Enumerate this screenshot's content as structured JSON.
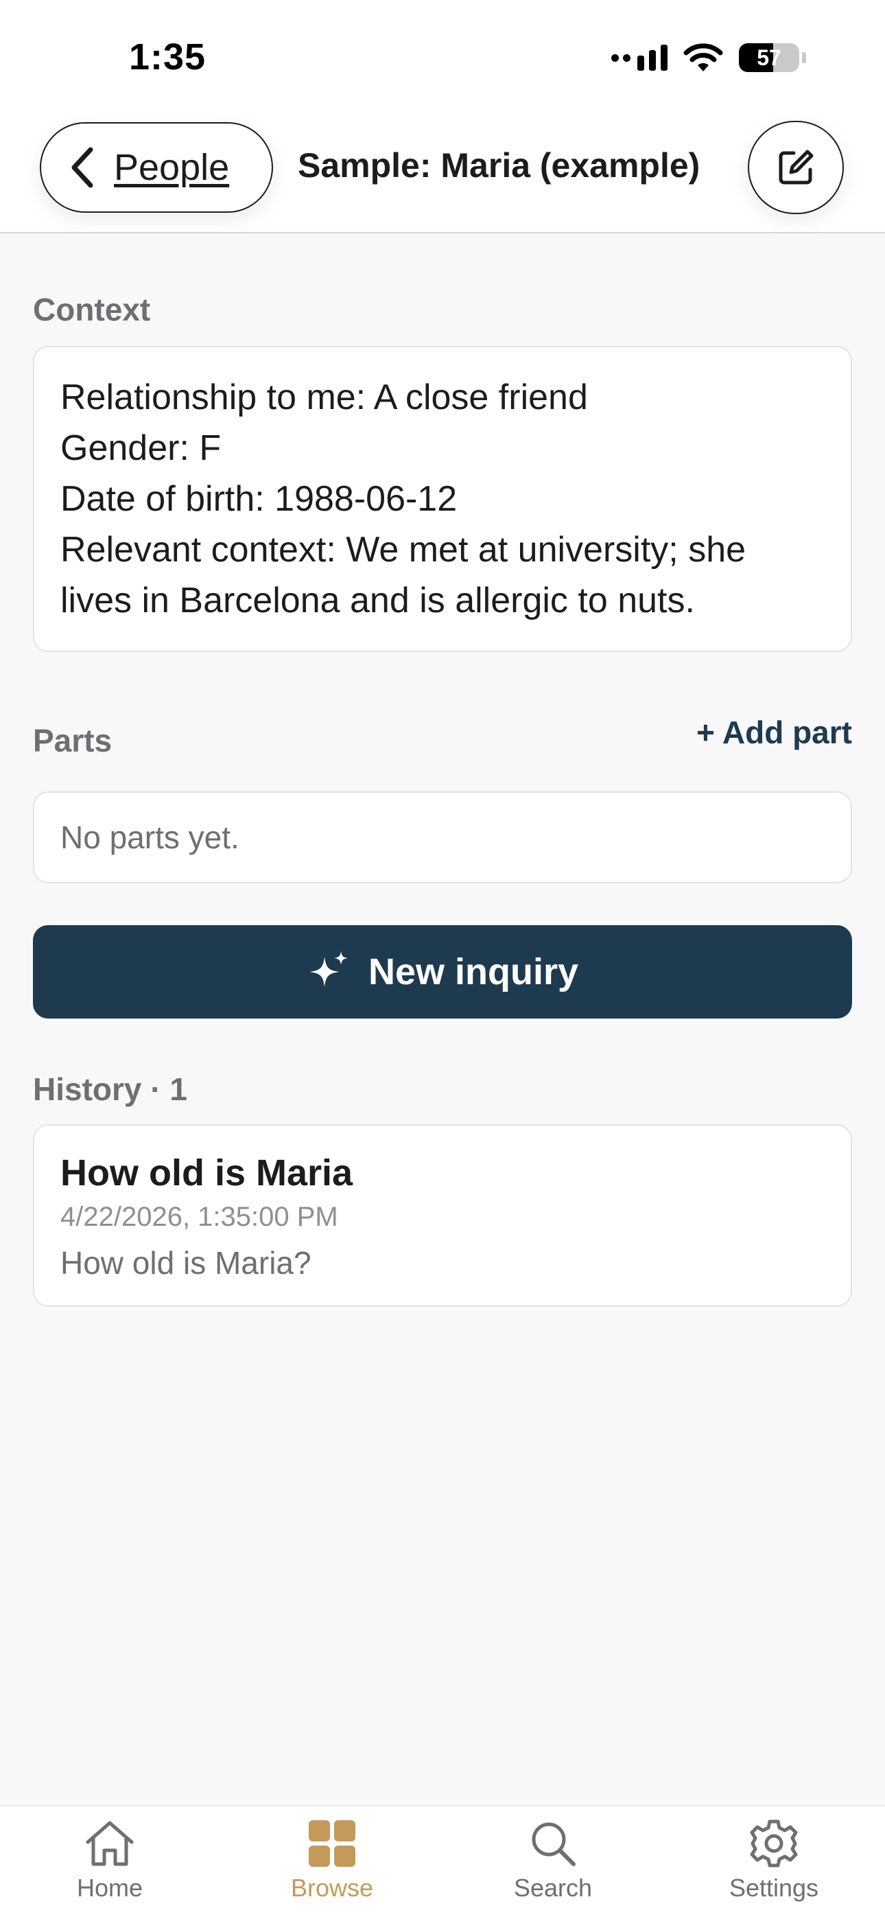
{
  "status_bar": {
    "time": "1:35",
    "battery": "57",
    "battery_level_percent": 57
  },
  "nav": {
    "back_label": "People",
    "title": "Sample: Maria (example)",
    "back_icon": "chevron-left-icon",
    "edit_icon": "compose-icon"
  },
  "context": {
    "label": "Context",
    "lines": [
      "Relationship to me: A close friend",
      "Gender: F",
      "Date of birth: 1988-06-12",
      "Relevant context: We met at university; she",
      "lives in Barcelona and is allergic to nuts."
    ]
  },
  "parts": {
    "label": "Parts",
    "add_label": "+ Add part",
    "empty_text": "No parts yet."
  },
  "new_inquiry": {
    "label": "New inquiry",
    "icon": "sparkles-icon"
  },
  "history": {
    "label": "History · 1",
    "items": [
      {
        "title": "How old is Maria",
        "date": "4/22/2026, 1:35:00 PM",
        "preview": "How old is Maria?"
      }
    ]
  },
  "tab_bar": {
    "items": [
      {
        "label": "Home",
        "icon": "house-icon",
        "active": false
      },
      {
        "label": "Browse",
        "icon": "grid-icon",
        "active": true
      },
      {
        "label": "Search",
        "icon": "magnifier-icon",
        "active": false
      },
      {
        "label": "Settings",
        "icon": "gear-icon",
        "active": false
      }
    ]
  },
  "colors": {
    "primary": "#1e3a4f",
    "accent": "#c49a5a",
    "background": "#f8f8f8",
    "muted_text": "#6e6e73"
  }
}
